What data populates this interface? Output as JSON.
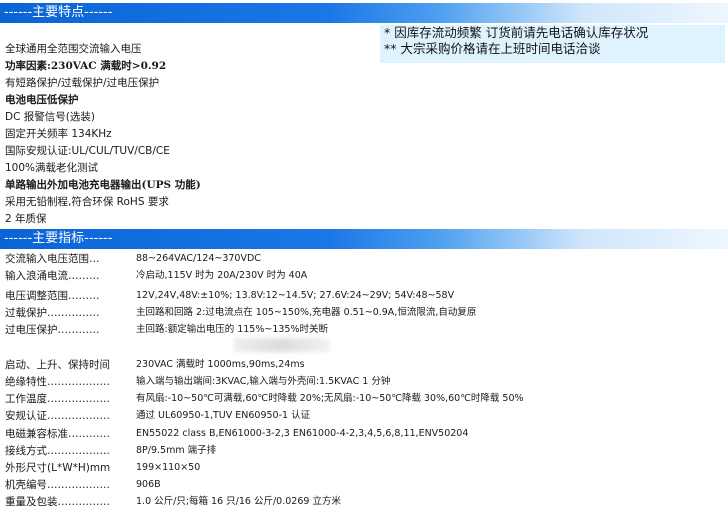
{
  "features_header": "------主要特点------",
  "notice": [
    "* 因库存流动频繁 订货前请先电话确认库存状况",
    "** 大宗采购价格请在上班时间电话洽谈"
  ],
  "features": [
    {
      "text": "全球通用全范围交流输入电压",
      "bold": false
    },
    {
      "text": "功率因素:230VAC 满载时>0.92",
      "bold": true
    },
    {
      "text": "有短路保护/过载保护/过电压保护",
      "bold": false
    },
    {
      "text": "电池电压低保护",
      "bold": true
    },
    {
      "text": "DC 报警信号(选装)",
      "bold": false
    },
    {
      "text": "固定开关频率 134KHz",
      "bold": false
    },
    {
      "text": "国际安规认证:UL/CUL/TUV/CB/CE",
      "bold": false
    },
    {
      "text": "100%满载老化测试",
      "bold": false
    },
    {
      "text": "单路输出外加电池充电器输出(UPS 功能)",
      "bold": true
    },
    {
      "text": "采用无铅制程,符合环保 RoHS 要求",
      "bold": false
    },
    {
      "text": "2 年质保",
      "bold": false
    }
  ],
  "specs_header": "------主要指标------",
  "specs": [
    {
      "label": "交流输入电压范围…",
      "value": "88~264VAC/124~370VDC"
    },
    {
      "label": "输入浪涌电流………",
      "value": "冷启动,115V 时为 20A/230V 时为 40A"
    },
    {
      "label": "电压调整范围………",
      "value": "12V,24V,48V:±10%; 13.8V:12~14.5V; 27.6V:24~29V; 54V:48~58V"
    },
    {
      "label": "过载保护……………",
      "value": "主回路和回路 2:过电流点在 105~150%,充电器 0.51~0.9A,恒流限流,自动复原"
    },
    {
      "label": "过电压保护…………",
      "value": "主回路:额定输出电压的 115%~135%时关断"
    },
    {
      "label": "",
      "value": ""
    },
    {
      "label": "启动、上升、保持时间",
      "value": "230VAC 满载时 1000ms,90ms,24ms"
    },
    {
      "label": "绝缘特性………………",
      "value": "输入端与输出端间:3KVAC,输入端与外壳间:1.5KVAC 1 分钟"
    },
    {
      "label": "工作温度………………",
      "value": "有风扇:-10~50℃可满载,60℃时降载 20%;无风扇:-10~50℃降载 30%,60℃时降载 50%"
    },
    {
      "label": "安规认证………………",
      "value": "通过 UL60950-1,TUV EN60950-1 认证"
    },
    {
      "label": "电磁兼容标准…………",
      "value": "EN55022 class B,EN61000-3-2,3 EN61000-4-2,3,4,5,6,8,11,ENV50204"
    },
    {
      "label": "接线方式………………",
      "value": "8P/9.5mm 端子排"
    },
    {
      "label": "外形尺寸(L*W*H)mm",
      "value": "199×110×50"
    },
    {
      "label": "机壳编号………………",
      "value": "906B"
    },
    {
      "label": "重量及包装……………",
      "value": "1.0 公斤/只;每箱 16 只/16 公斤/0.0269 立方米"
    }
  ]
}
